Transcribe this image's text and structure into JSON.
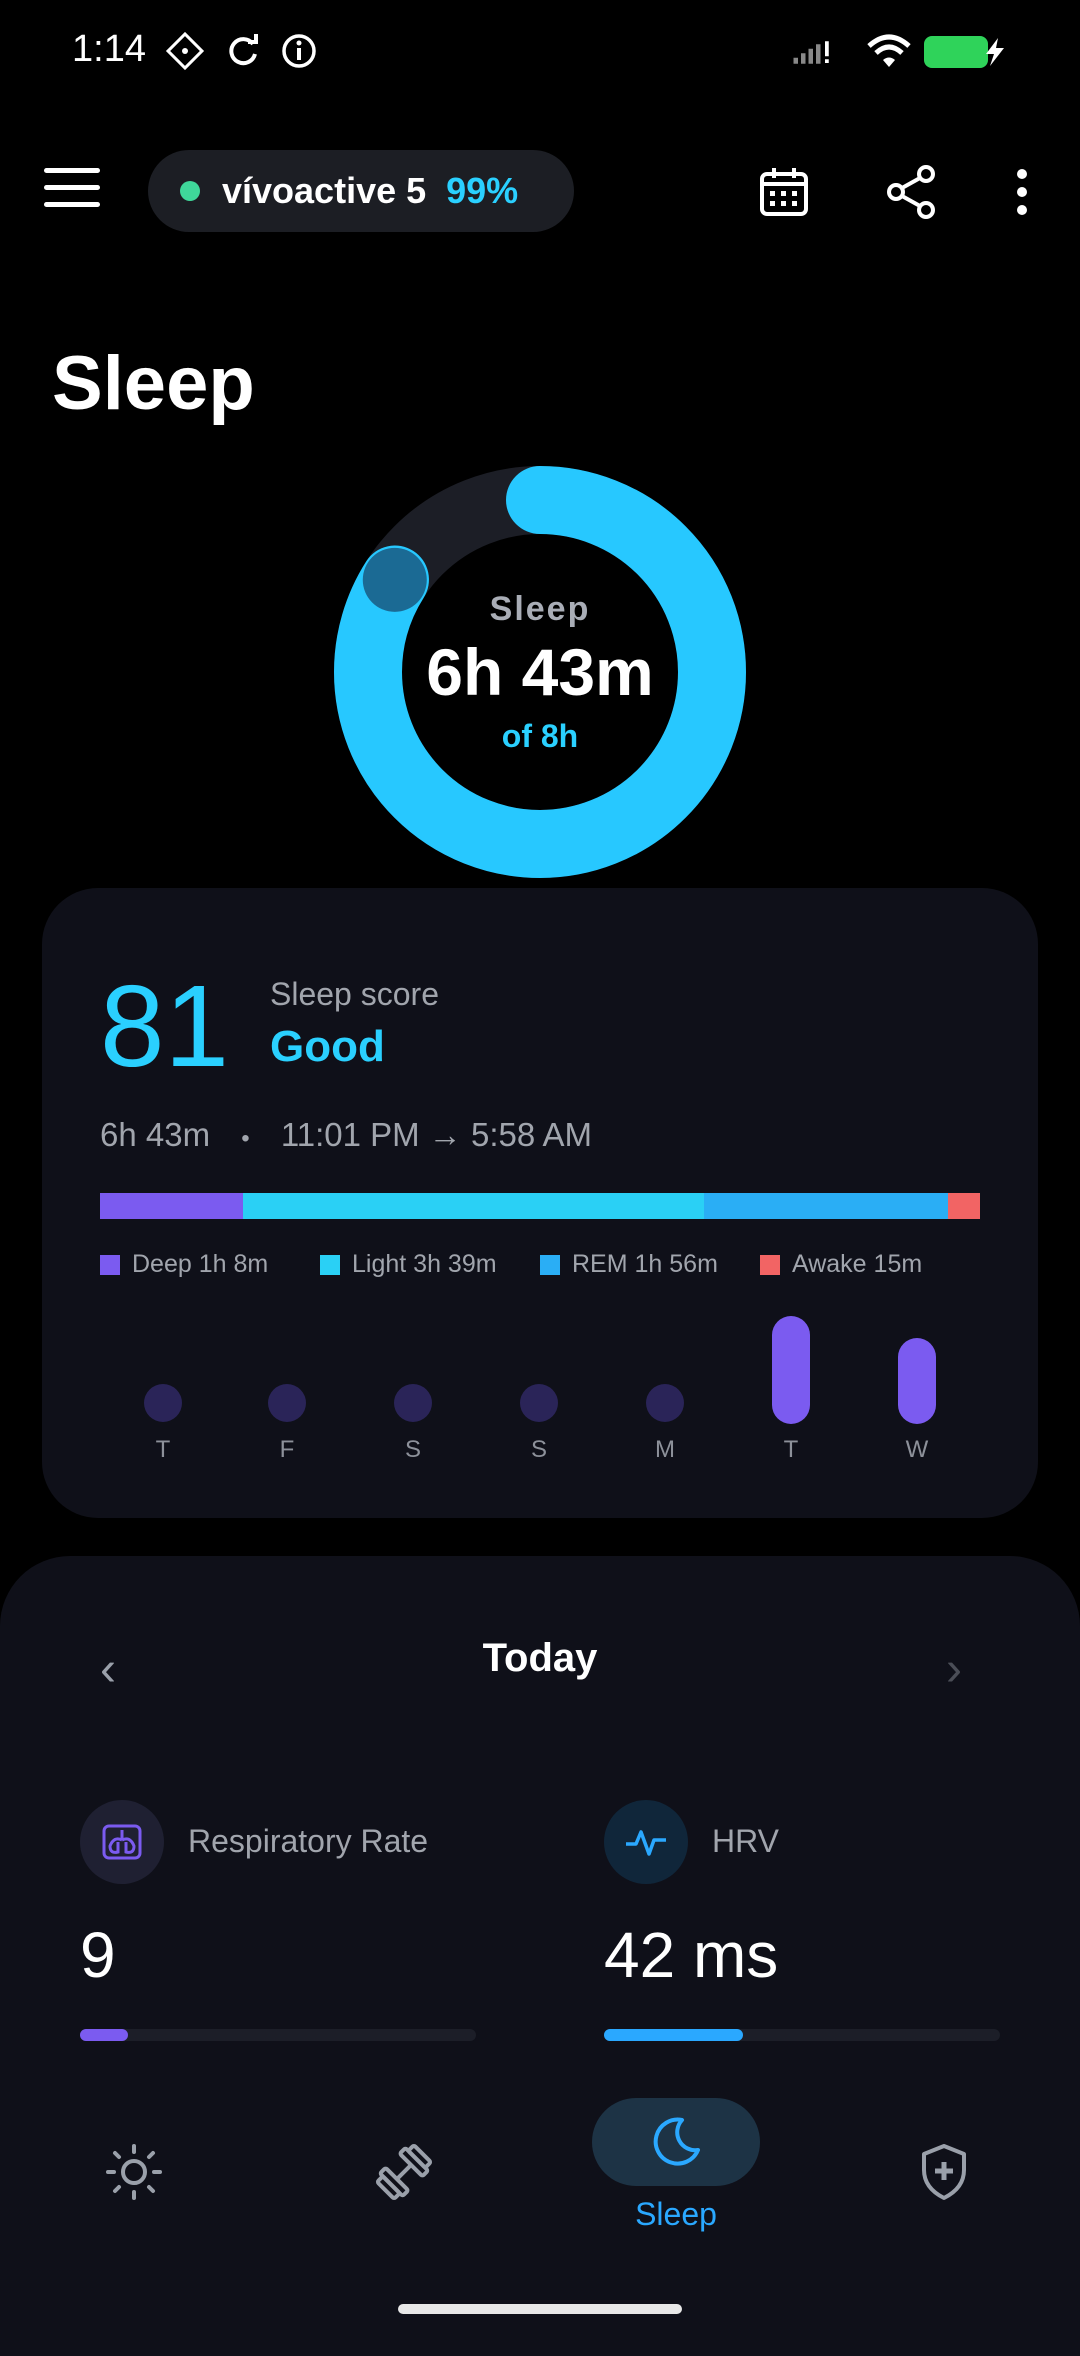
{
  "status_bar": {
    "time": "1:14",
    "icons": [
      "app-icon",
      "sync-icon",
      "info-icon",
      "signal-icon",
      "wifi-icon",
      "battery-charging-icon"
    ]
  },
  "top_bar": {
    "device_name": "vívoactive 5",
    "battery": "99%",
    "actions": [
      "calendar-icon",
      "share-icon",
      "more-vertical-icon"
    ]
  },
  "page_title": "Sleep",
  "sleep_ring": {
    "label": "Sleep",
    "value": "6h 43m",
    "goal": "of 8h",
    "progress": 0.84
  },
  "score_card": {
    "score": "81",
    "label": "Sleep score",
    "quality": "Good",
    "duration": "6h 43m",
    "separator": "•",
    "time_range": "11:01 PM → 5:58 AM",
    "stages": [
      {
        "name": "Deep",
        "value": "1h 8m",
        "minutes": 68,
        "color": "#7b5bf0"
      },
      {
        "name": "Light",
        "value": "3h 39m",
        "minutes": 219,
        "color": "#2ad0f5"
      },
      {
        "name": "REM",
        "value": "1h 56m",
        "minutes": 116,
        "color": "#2aaef5"
      },
      {
        "name": "Awake",
        "value": "15m",
        "minutes": 15,
        "color": "#f26464"
      }
    ],
    "week": [
      {
        "day": "T",
        "has_bar": false
      },
      {
        "day": "F",
        "has_bar": false
      },
      {
        "day": "S",
        "has_bar": false
      },
      {
        "day": "S",
        "has_bar": false
      },
      {
        "day": "M",
        "has_bar": false
      },
      {
        "day": "T",
        "has_bar": true,
        "level": 1.0
      },
      {
        "day": "W",
        "has_bar": true,
        "level": 0.8
      }
    ]
  },
  "today": {
    "title": "Today",
    "prev": "‹",
    "next": "›",
    "metrics": [
      {
        "name": "Respiratory Rate",
        "value": "9",
        "progress": 0.12,
        "color": "#7b5bf0",
        "icon": "lungs-icon"
      },
      {
        "name": "HRV",
        "value": "42 ms",
        "progress": 0.35,
        "color": "#2aa8ff",
        "icon": "pulse-icon"
      }
    ]
  },
  "bottom_nav": {
    "items": [
      {
        "icon": "sun-icon"
      },
      {
        "icon": "dumbbell-icon"
      },
      {
        "icon": "moon-icon",
        "label": "Sleep",
        "active": true
      },
      {
        "icon": "shield-plus-icon"
      }
    ]
  }
}
